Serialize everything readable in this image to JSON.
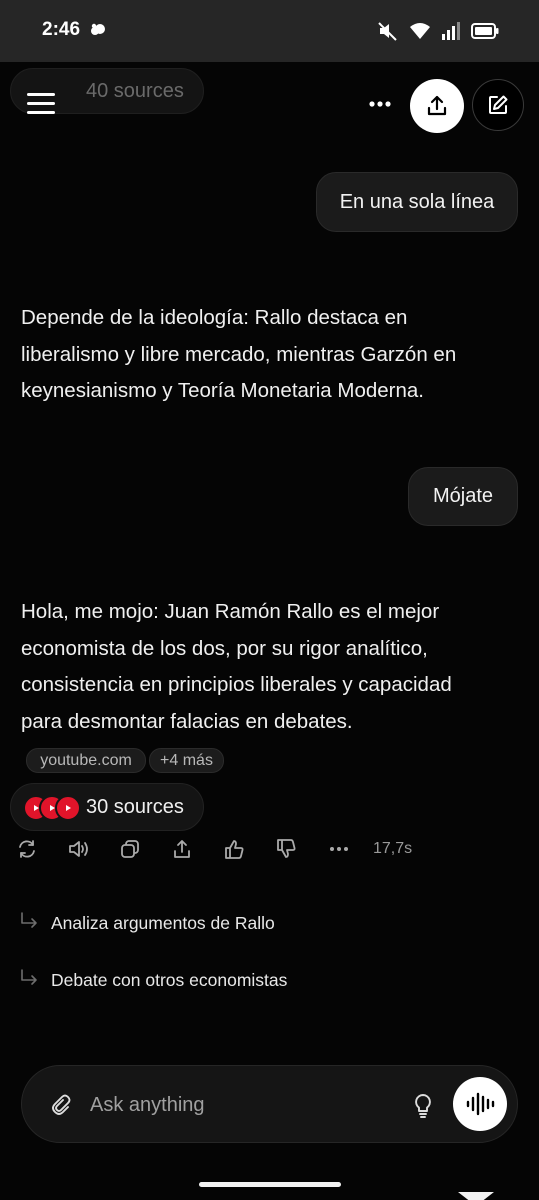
{
  "status_bar": {
    "time": "2:46",
    "icons": [
      "cloud-icon",
      "mute-icon",
      "wifi-icon",
      "signal-icon",
      "battery-icon"
    ]
  },
  "header": {
    "sources_label": "40 sources",
    "menu_icon": "hamburger-menu-icon",
    "more_icon": "more-horizontal-icon",
    "share_icon": "share-upload-icon",
    "new_chat_icon": "edit-compose-icon"
  },
  "messages": [
    {
      "role": "user",
      "text": "En una sola línea"
    },
    {
      "role": "assistant",
      "lines": [
        "Depende de la ideología: Rallo destaca en",
        "liberalismo y libre mercado, mientras Garzón en",
        "keynesianismo y Teoría Monetaria Moderna."
      ]
    },
    {
      "role": "user",
      "text": "Mójate"
    },
    {
      "role": "assistant",
      "lines": [
        "Hola, me mojo: Juan Ramón Rallo es el mejor",
        "economista de los dos, por su rigor analítico,",
        "consistencia en principios liberales y capacidad",
        "para desmontar falacias en debates."
      ],
      "citations": [
        "youtube.com",
        "+4 más"
      ],
      "sources_label": "30 sources",
      "elapsed": "17,7s"
    }
  ],
  "actions": [
    "rewrite-icon",
    "speaker-icon",
    "copy-icon",
    "share-icon",
    "thumbs-up-icon",
    "thumbs-down-icon",
    "more-horizontal-icon"
  ],
  "suggestions": [
    "Analiza argumentos de Rallo",
    "Debate con otros economistas"
  ],
  "composer": {
    "placeholder": "Ask anything",
    "attach_icon": "paperclip-icon",
    "think_icon": "lightbulb-icon",
    "voice_icon": "voice-waveform-icon"
  },
  "colors": {
    "background": "#050505",
    "status_bar": "#262626",
    "bubble": "#1b1b1b",
    "youtube_red": "#e1142a"
  }
}
